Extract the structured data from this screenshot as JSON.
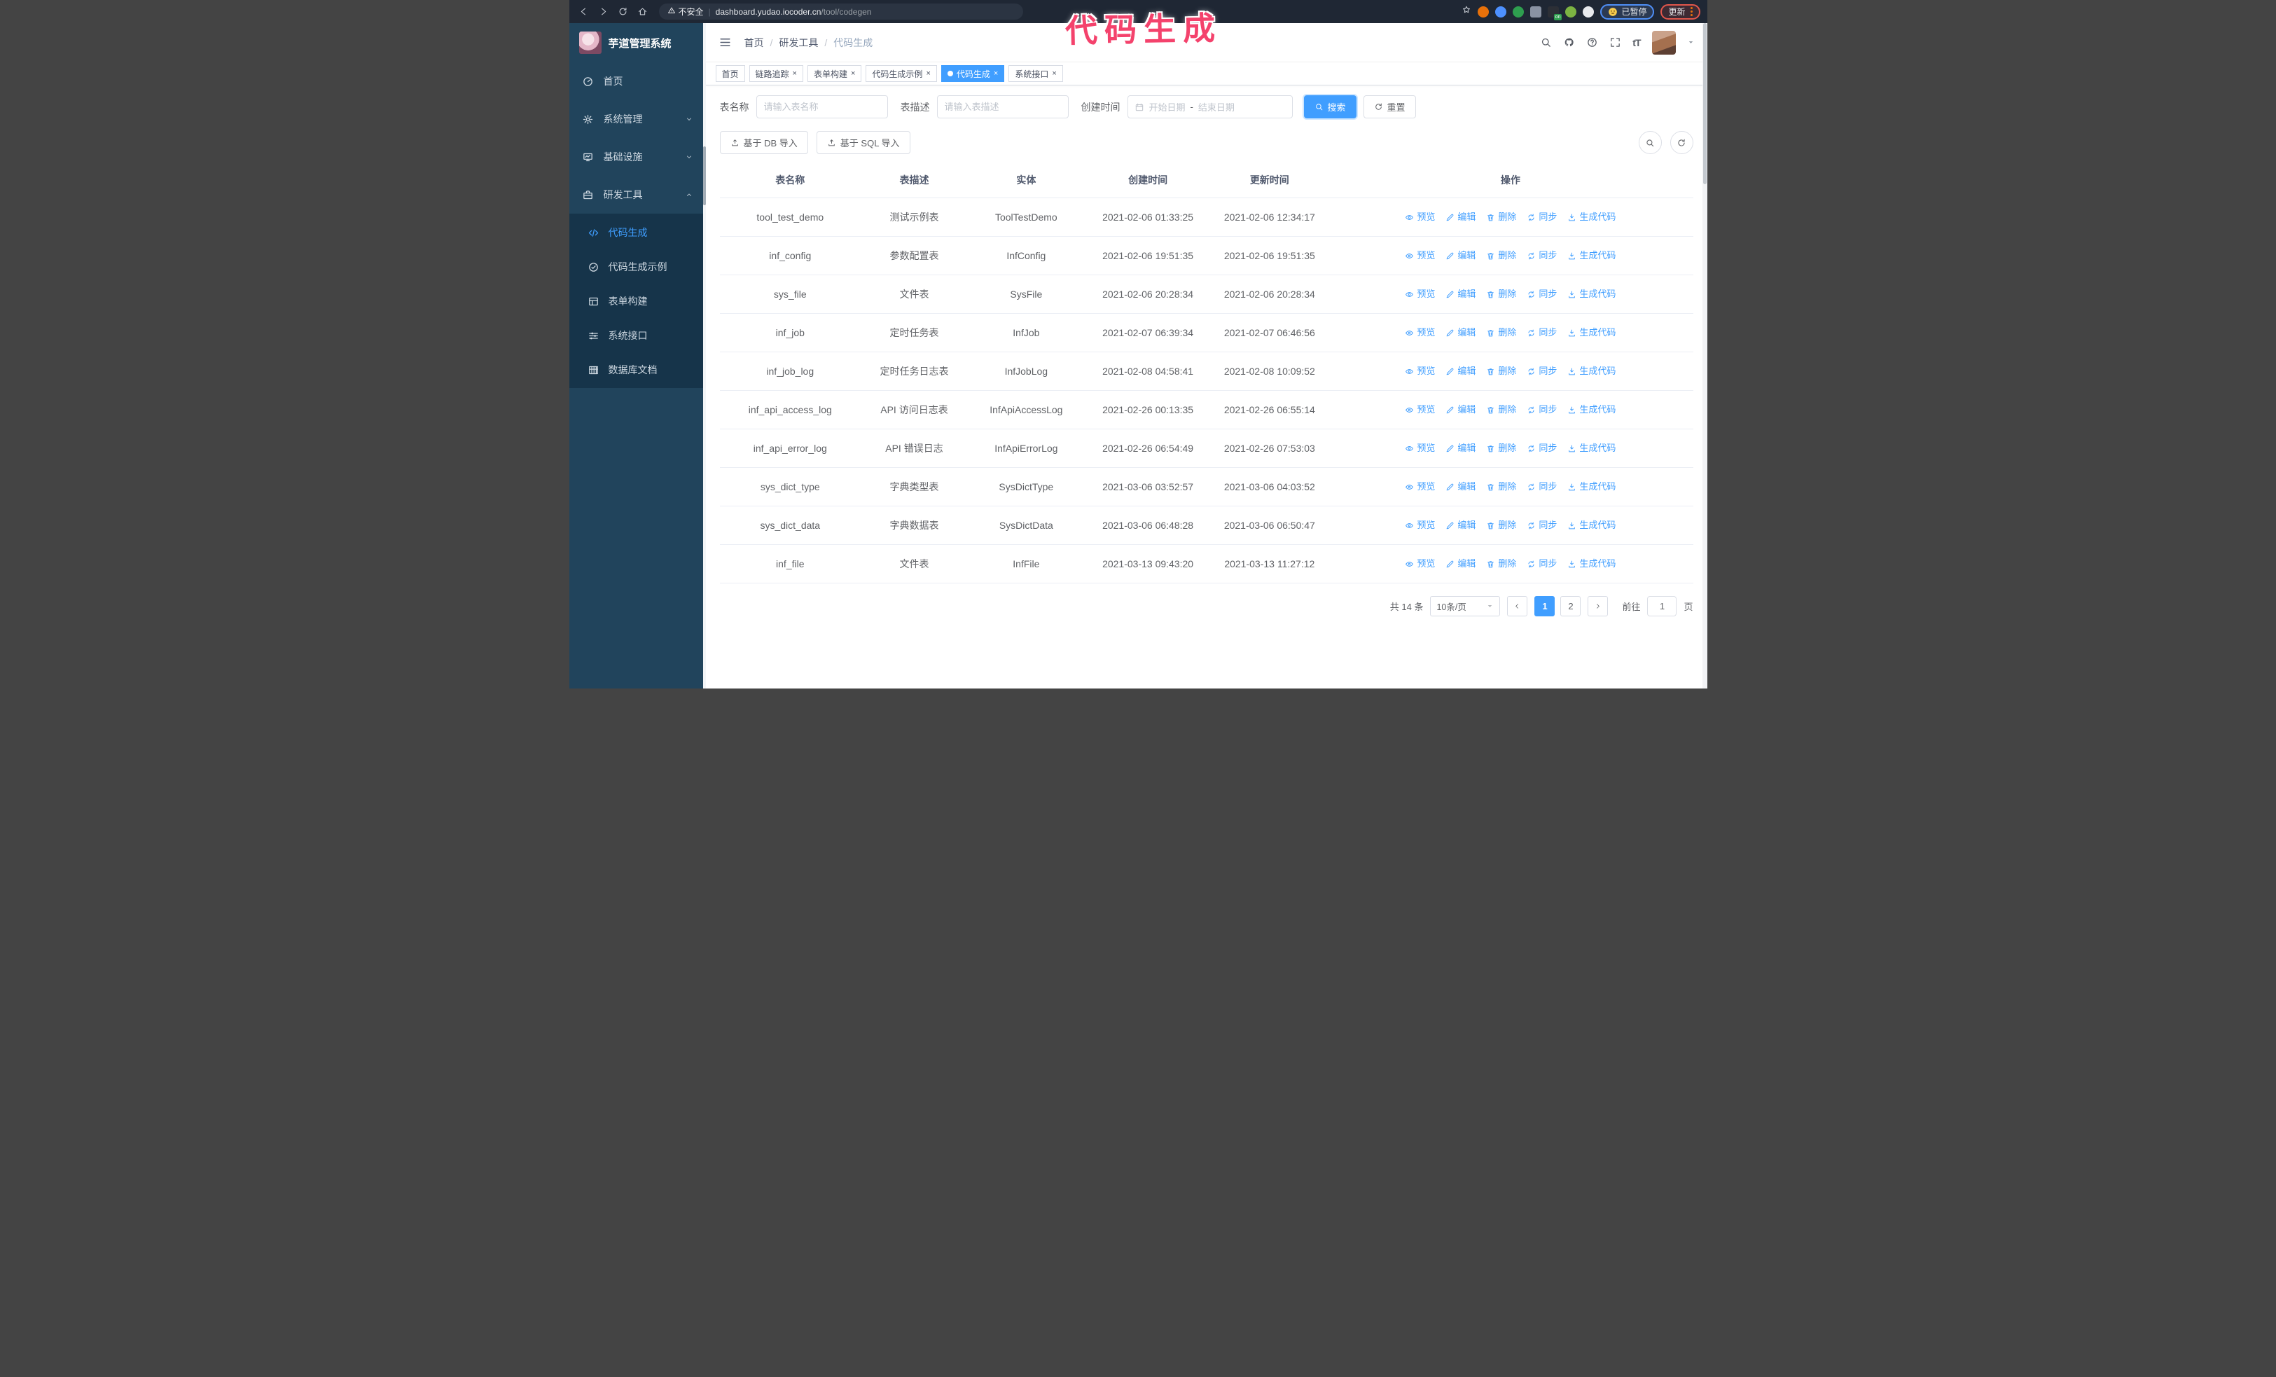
{
  "annotation": {
    "text": "代码生成",
    "color": "#f4426c"
  },
  "browser": {
    "insecure_label": "不安全",
    "url_host": "dashboard.yudao.iocoder.cn",
    "url_path": "/tool/codegen",
    "profile_badge": "已暂停",
    "update_badge": "更新",
    "extensions": [
      {
        "name": "extension-orange-icon",
        "color": "#e8710a",
        "shape": "round"
      },
      {
        "name": "extension-blue-gem-icon",
        "color": "#4d90fe",
        "shape": "round"
      },
      {
        "name": "extension-green-shield-icon",
        "color": "#2e9e4f",
        "shape": "round"
      },
      {
        "name": "extension-grid-icon",
        "color": "#8a93a3",
        "shape": "square"
      },
      {
        "name": "extension-dark-on-icon",
        "color": "#2c2f36",
        "shape": "square",
        "badge": "on"
      },
      {
        "name": "extension-green-man-icon",
        "color": "#7cb342",
        "shape": "round"
      },
      {
        "name": "extension-puzzle-icon",
        "color": "#e8eaed",
        "shape": "round"
      }
    ]
  },
  "sidebar": {
    "app_title": "芋道管理系统",
    "menu": [
      {
        "label": "首页",
        "icon": "dashboard-icon"
      },
      {
        "label": "系统管理",
        "icon": "gear-icon",
        "chevron": "down"
      },
      {
        "label": "基础设施",
        "icon": "monitor-icon",
        "chevron": "down"
      },
      {
        "label": "研发工具",
        "icon": "toolbox-icon",
        "chevron": "up"
      }
    ],
    "submenu": [
      {
        "label": "代码生成",
        "icon": "code-icon",
        "active": true
      },
      {
        "label": "代码生成示例",
        "icon": "check-circle-icon",
        "active": false
      },
      {
        "label": "表单构建",
        "icon": "form-icon",
        "active": false
      },
      {
        "label": "系统接口",
        "icon": "sliders-icon",
        "active": false
      },
      {
        "label": "数据库文档",
        "icon": "table-grid-icon",
        "active": false
      }
    ]
  },
  "header": {
    "breadcrumb": [
      "首页",
      "研发工具",
      "代码生成"
    ]
  },
  "tabs": [
    {
      "label": "首页",
      "closable": false,
      "active": false
    },
    {
      "label": "链路追踪",
      "closable": true,
      "active": false
    },
    {
      "label": "表单构建",
      "closable": true,
      "active": false
    },
    {
      "label": "代码生成示例",
      "closable": true,
      "active": false
    },
    {
      "label": "代码生成",
      "closable": true,
      "active": true
    },
    {
      "label": "系统接口",
      "closable": true,
      "active": false
    }
  ],
  "filters": {
    "table_name_label": "表名称",
    "table_name_placeholder": "请输入表名称",
    "table_desc_label": "表描述",
    "table_desc_placeholder": "请输入表描述",
    "create_time_label": "创建时间",
    "start_placeholder": "开始日期",
    "range_separator": "-",
    "end_placeholder": "结束日期",
    "search_label": "搜索",
    "reset_label": "重置"
  },
  "toolbar": {
    "import_db_label": "基于 DB 导入",
    "import_sql_label": "基于 SQL 导入"
  },
  "table": {
    "columns": [
      "表名称",
      "表描述",
      "实体",
      "创建时间",
      "更新时间",
      "操作"
    ],
    "actions": [
      {
        "label": "预览",
        "icon": "eye-icon"
      },
      {
        "label": "编辑",
        "icon": "edit-icon"
      },
      {
        "label": "删除",
        "icon": "delete-icon"
      },
      {
        "label": "同步",
        "icon": "sync-icon"
      },
      {
        "label": "生成代码",
        "icon": "download-icon"
      }
    ],
    "rows": [
      {
        "name": "tool_test_demo",
        "desc": "测试示例表",
        "entity": "ToolTestDemo",
        "created": "2021-02-06 01:33:25",
        "updated": "2021-02-06 12:34:17"
      },
      {
        "name": "inf_config",
        "desc": "参数配置表",
        "entity": "InfConfig",
        "created": "2021-02-06 19:51:35",
        "updated": "2021-02-06 19:51:35"
      },
      {
        "name": "sys_file",
        "desc": "文件表",
        "entity": "SysFile",
        "created": "2021-02-06 20:28:34",
        "updated": "2021-02-06 20:28:34"
      },
      {
        "name": "inf_job",
        "desc": "定时任务表",
        "entity": "InfJob",
        "created": "2021-02-07 06:39:34",
        "updated": "2021-02-07 06:46:56"
      },
      {
        "name": "inf_job_log",
        "desc": "定时任务日志表",
        "entity": "InfJobLog",
        "created": "2021-02-08 04:58:41",
        "updated": "2021-02-08 10:09:52"
      },
      {
        "name": "inf_api_access_log",
        "desc": "API 访问日志表",
        "entity": "InfApiAccessLog",
        "created": "2021-02-26 00:13:35",
        "updated": "2021-02-26 06:55:14"
      },
      {
        "name": "inf_api_error_log",
        "desc": "API 错误日志",
        "entity": "InfApiErrorLog",
        "created": "2021-02-26 06:54:49",
        "updated": "2021-02-26 07:53:03"
      },
      {
        "name": "sys_dict_type",
        "desc": "字典类型表",
        "entity": "SysDictType",
        "created": "2021-03-06 03:52:57",
        "updated": "2021-03-06 04:03:52"
      },
      {
        "name": "sys_dict_data",
        "desc": "字典数据表",
        "entity": "SysDictData",
        "created": "2021-03-06 06:48:28",
        "updated": "2021-03-06 06:50:47"
      },
      {
        "name": "inf_file",
        "desc": "文件表",
        "entity": "InfFile",
        "created": "2021-03-13 09:43:20",
        "updated": "2021-03-13 11:27:12"
      }
    ]
  },
  "pagination": {
    "total_label": "共 14 条",
    "page_size": "10条/页",
    "pages": [
      "1",
      "2"
    ],
    "active_page": "1",
    "goto_label": "前往",
    "goto_value": "1",
    "page_unit": "页"
  },
  "colors": {
    "primary": "#409eff",
    "sidebar_bg": "#21445c",
    "submenu_bg": "#16344a",
    "annotation": "#f4426c"
  }
}
